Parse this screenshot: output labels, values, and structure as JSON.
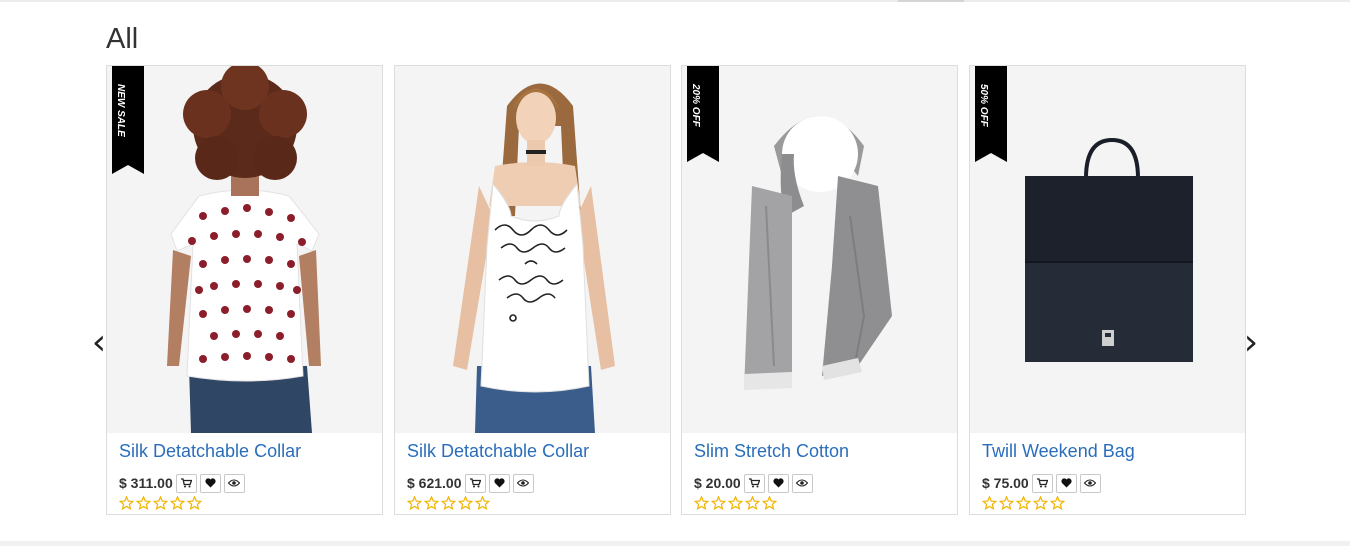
{
  "section": {
    "title": "All"
  },
  "carousel": {
    "prev_icon": "chevron-left-icon",
    "prev_glyph": "‹",
    "next_icon": "chevron-right-icon",
    "next_glyph": "›"
  },
  "colors": {
    "title_link": "#2a6ebb",
    "ribbon": "#000000",
    "star_outline": "#f0b400",
    "image_bg": "#f4f4f4"
  },
  "products": [
    {
      "name": "Silk Detatchable Collar",
      "price": "$ 311.00",
      "badge": "NEW SALE",
      "image": "woman in white polka-dot t-shirt, back view",
      "rating": 0,
      "max_rating": 5
    },
    {
      "name": "Silk Detatchable Collar",
      "price": "$ 621.00",
      "badge": "",
      "image": "woman in white printed tank top",
      "rating": 0,
      "max_rating": 5
    },
    {
      "name": "Slim Stretch Cotton",
      "price": "$ 20.00",
      "badge": "20% OFF",
      "image": "grey knit scarf",
      "rating": 0,
      "max_rating": 5
    },
    {
      "name": "Twill Weekend Bag",
      "price": "$ 75.00",
      "badge": "50% OFF",
      "image": "black tote bag",
      "rating": 0,
      "max_rating": 5
    }
  ],
  "actions": {
    "cart_icon": "cart-icon",
    "wishlist_icon": "heart-icon",
    "quickview_icon": "eye-icon"
  }
}
